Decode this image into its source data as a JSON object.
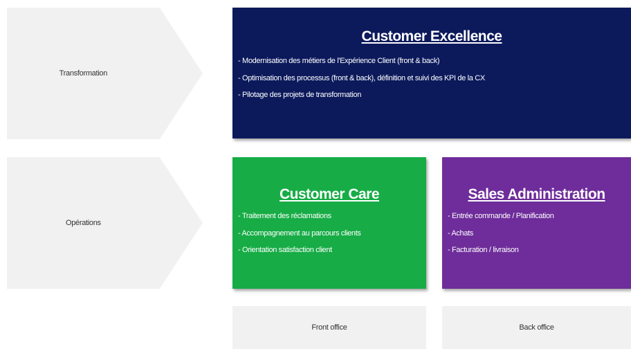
{
  "rows": {
    "transformation_label": "Transformation",
    "operations_label": "Opérations"
  },
  "customer_excellence": {
    "title": "Customer Excellence",
    "color": "#0c1a5c",
    "items": [
      "- Modernisation des métiers de l'Expérience Client (front & back)",
      "- Optimisation des processus (front & back), définition et suivi des KPI de la CX",
      "- Pilotage des projets de transformation"
    ]
  },
  "customer_care": {
    "title": "Customer Care",
    "color": "#17ac46",
    "items": [
      "- Traitement des réclamations",
      "- Accompagnement au parcours clients",
      "- Orientation satisfaction client"
    ]
  },
  "sales_administration": {
    "title": "Sales Administration",
    "color": "#6e2d9a",
    "items": [
      "- Entrée commande / Planification",
      "- Achats",
      "- Facturation / livraison"
    ]
  },
  "columns": {
    "front_label": "Front office",
    "back_label": "Back office"
  }
}
